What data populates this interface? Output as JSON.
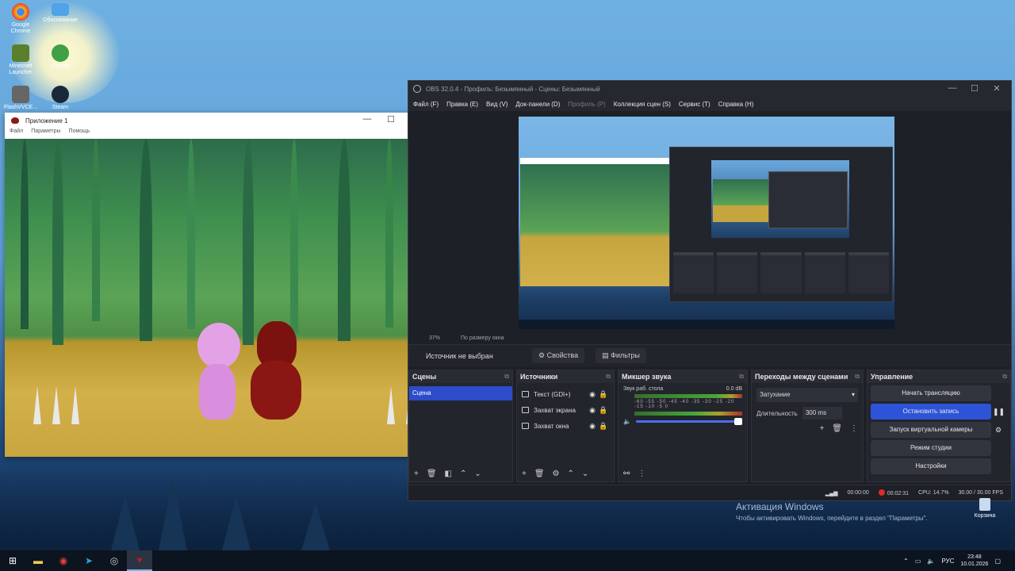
{
  "desktop": {
    "icons": [
      {
        "label": "Google Chrome",
        "name": "chrome-icon",
        "color": "#e94235"
      },
      {
        "label": "Minecraft Launcher",
        "name": "minecraft-icon",
        "color": "#5b7f2c"
      },
      {
        "label": "FlashVVCE...",
        "name": "flash-icon",
        "color": "#666666"
      },
      {
        "label": "Обоснование",
        "name": "folder-icon",
        "color": "#4fa3e6"
      },
      {
        "label": "uTorrent",
        "name": "utorrent-icon",
        "color": "#3fa046"
      },
      {
        "label": "Steam",
        "name": "steam-icon",
        "color": "#1b2838"
      }
    ],
    "activation_title": "Активация Windows",
    "activation_text": "Чтобы активировать Windows, перейдите в раздел \"Параметры\".",
    "recycle_label": "Корзина"
  },
  "game_window": {
    "title": "Приложение 1",
    "menu": [
      "Файл",
      "Параметры",
      "Помощь"
    ],
    "minimize": "—",
    "maximize": "☐",
    "close": "✕"
  },
  "obs": {
    "title": "OBS 32.0.4 - Профиль: Безымянный - Сцены: Безымянный",
    "minimize": "—",
    "maximize": "☐",
    "close": "✕",
    "menu": [
      {
        "label": "Файл (F)",
        "dim": false
      },
      {
        "label": "Правка (E)",
        "dim": false
      },
      {
        "label": "Вид (V)",
        "dim": false
      },
      {
        "label": "Док-панели (D)",
        "dim": false
      },
      {
        "label": "Профиль (P)",
        "dim": true
      },
      {
        "label": "Коллекция сцен (S)",
        "dim": false
      },
      {
        "label": "Сервис (T)",
        "dim": false
      },
      {
        "label": "Справка (H)",
        "dim": false
      }
    ],
    "zoom": "37%",
    "scale_mode": "По размеру окна",
    "no_source": "Источник не выбран",
    "properties_btn": "Свойства",
    "filters_btn": "Фильтры",
    "scenes_header": "Сцены",
    "scene_selected": "Сцена",
    "sources_header": "Источники",
    "sources": [
      {
        "name": "Текст (GDI+)"
      },
      {
        "name": "Захват экрана"
      },
      {
        "name": "Захват окна"
      }
    ],
    "mixer_header": "Микшер звука",
    "mixer_track": "Звук раб. стола",
    "mixer_db": "0.0 dB",
    "mixer_scale": "-60 -55 -50 -45 -40 -35 -30 -25 -20 -15 -10 -5 0",
    "transitions_header": "Переходы между сценами",
    "transition_type": "Затухание",
    "duration_label": "Длительность",
    "duration_value": "300 ms",
    "controls_header": "Управление",
    "controls": {
      "start_stream": "Начать трансляцию",
      "stop_record": "Остановить запись",
      "virtual_cam": "Запуск виртуальной камеры",
      "studio_mode": "Режим студии",
      "settings": "Настройки"
    },
    "status": {
      "stream_time": "00:00:00",
      "rec_time": "00:02:31",
      "cpu": "CPU: 14.7%",
      "fps": "30.00 / 30.00 FPS"
    },
    "accent": "#2d54d8"
  },
  "taskbar": {
    "lang": "РУС",
    "time": "23:48",
    "date": "10.01.2026"
  }
}
